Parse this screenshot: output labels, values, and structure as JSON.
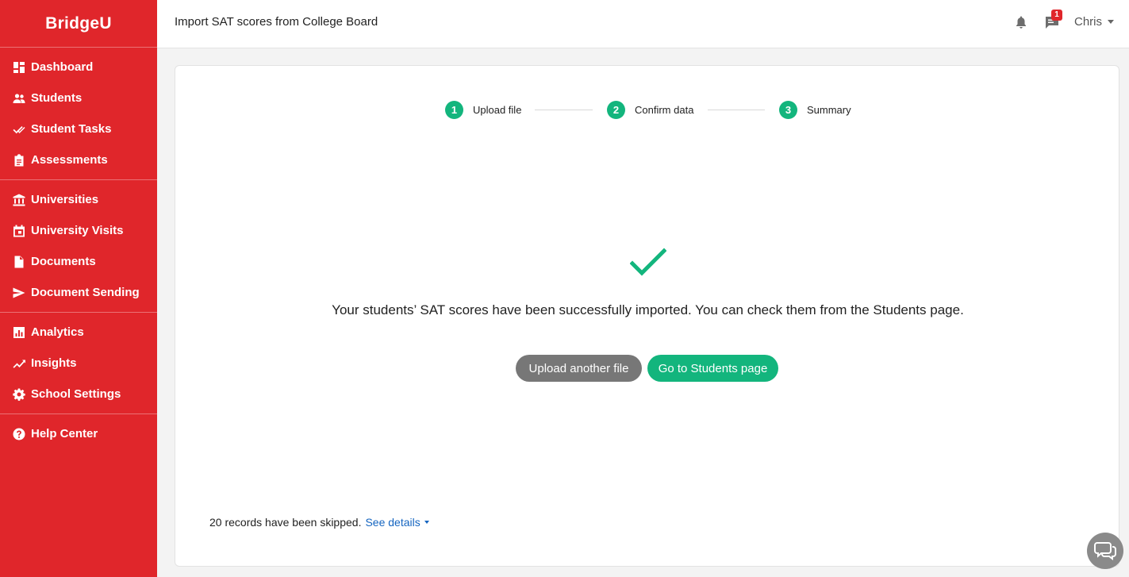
{
  "app": {
    "logo_text": "BridgeU"
  },
  "sidebar": {
    "groups": [
      {
        "items": [
          {
            "label": "Dashboard",
            "icon": "dashboard-icon"
          },
          {
            "label": "Students",
            "icon": "people-icon"
          },
          {
            "label": "Student Tasks",
            "icon": "double-check-icon"
          },
          {
            "label": "Assessments",
            "icon": "clipboard-icon"
          }
        ]
      },
      {
        "items": [
          {
            "label": "Universities",
            "icon": "bank-icon"
          },
          {
            "label": "University Visits",
            "icon": "calendar-icon"
          },
          {
            "label": "Documents",
            "icon": "document-icon"
          },
          {
            "label": "Document Sending",
            "icon": "send-icon"
          }
        ]
      },
      {
        "items": [
          {
            "label": "Analytics",
            "icon": "bar-chart-icon"
          },
          {
            "label": "Insights",
            "icon": "trend-icon"
          },
          {
            "label": "School Settings",
            "icon": "gear-icon"
          }
        ]
      },
      {
        "items": [
          {
            "label": "Help Center",
            "icon": "help-icon"
          }
        ]
      }
    ]
  },
  "header": {
    "title": "Import SAT scores from College Board",
    "notification_badge": "1",
    "user_name": "Chris"
  },
  "wizard": {
    "steps": [
      {
        "number": "1",
        "label": "Upload file"
      },
      {
        "number": "2",
        "label": "Confirm data"
      },
      {
        "number": "3",
        "label": "Summary"
      }
    ]
  },
  "result": {
    "message": "Your students’ SAT scores have been successfully imported. You can check them from the Students page.",
    "upload_another_label": "Upload another file",
    "go_students_label": "Go to Students page",
    "skipped_text": "20 records have been skipped.",
    "see_details_label": "See details"
  },
  "colors": {
    "brand_red": "#e0262b",
    "success_green": "#13b57d",
    "link_blue": "#1565c0"
  }
}
